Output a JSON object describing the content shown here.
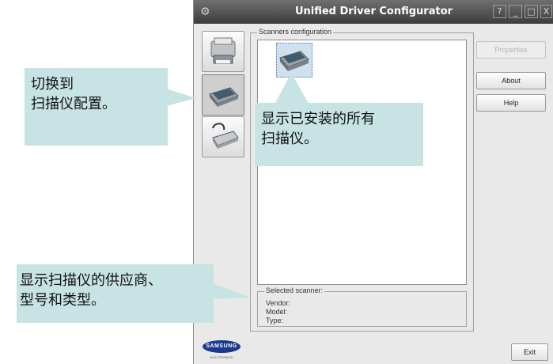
{
  "window": {
    "title": "Unified Driver Configurator",
    "controls": {
      "help": "?",
      "minimize": "_",
      "maximize": "□",
      "close": "X"
    }
  },
  "sidebar": {
    "items": [
      {
        "name": "printers",
        "icon": "printer-icon"
      },
      {
        "name": "scanners",
        "icon": "scanner-icon",
        "active": true
      },
      {
        "name": "ports",
        "icon": "port-icon"
      }
    ]
  },
  "main": {
    "group_title": "Scanners configuration",
    "selected": {
      "title": "Selected scanner:",
      "vendor": "Vendor:",
      "model": "Model:",
      "type": "Type:"
    }
  },
  "buttons": {
    "properties": "Properties",
    "about": "About",
    "help": "Help",
    "exit": "Exit"
  },
  "logo": {
    "brand": "SAMSUNG",
    "sub": "ELECTRONICS"
  },
  "callouts": {
    "switch": [
      "切换到",
      "扫描仪配置。"
    ],
    "show_all": [
      "显示已安装的所有",
      "扫描仪。"
    ],
    "show_info": [
      "显示扫描仪的供应商、",
      "型号和类型。"
    ]
  }
}
